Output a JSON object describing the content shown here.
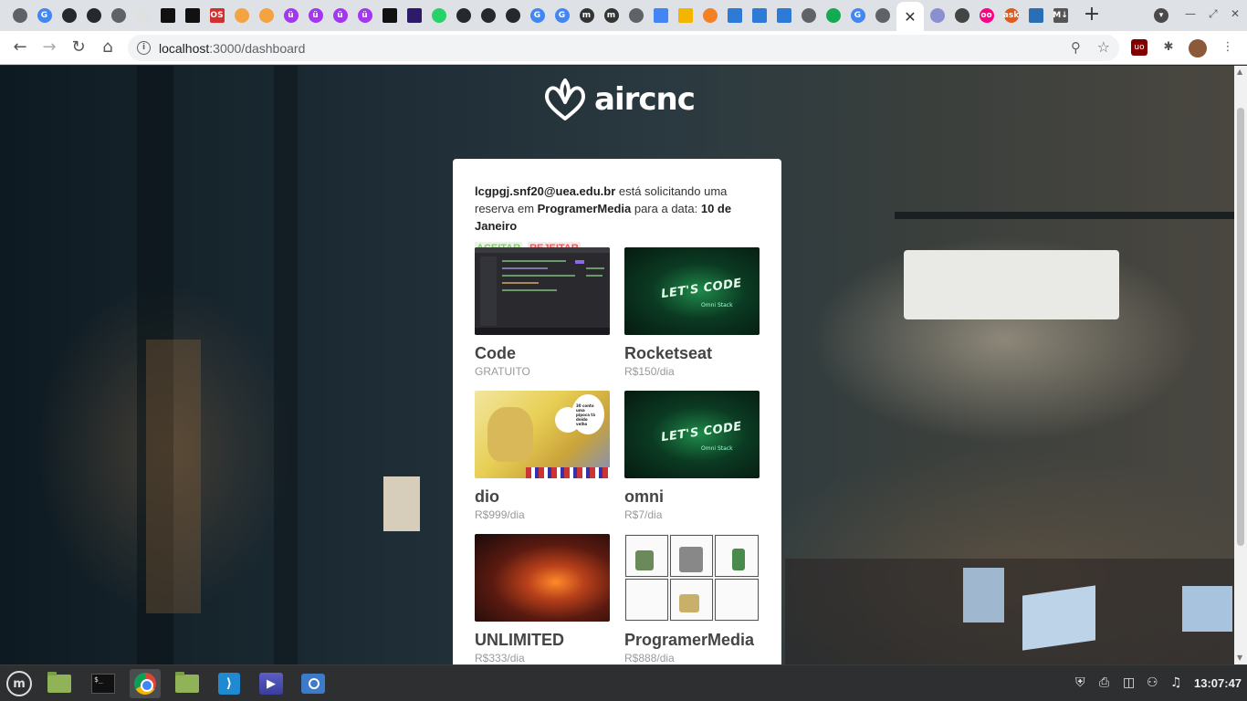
{
  "browser": {
    "active_tab_close": "✕",
    "new_tab": "+",
    "url_host": "localhost",
    "url_rest": ":3000/dashboard",
    "tab_favicons": [
      {
        "name": "globe-favicon",
        "label": "",
        "color": "#5f6368"
      },
      {
        "name": "google-favicon",
        "label": "G",
        "color": "#4285f4"
      },
      {
        "name": "github-favicon",
        "label": "",
        "color": "#24292e"
      },
      {
        "name": "github-favicon",
        "label": "",
        "color": "#24292e"
      },
      {
        "name": "globe-favicon",
        "label": "",
        "color": "#5f6368"
      },
      {
        "name": "blank-favicon",
        "label": "",
        "color": "#e0e0e0"
      },
      {
        "name": "codepen-favicon",
        "label": "",
        "color": "#111111"
      },
      {
        "name": "dev-favicon",
        "label": "",
        "color": "#111111"
      },
      {
        "name": "os-favicon",
        "label": "OS",
        "color": "#d32f2f"
      },
      {
        "name": "flag-favicon",
        "label": "",
        "color": "#f4a340"
      },
      {
        "name": "flag-favicon",
        "label": "",
        "color": "#f4a340"
      },
      {
        "name": "udemy-favicon",
        "label": "ü",
        "color": "#a435f0"
      },
      {
        "name": "udemy-favicon",
        "label": "ü",
        "color": "#a435f0"
      },
      {
        "name": "udemy-favicon",
        "label": "ü",
        "color": "#a435f0"
      },
      {
        "name": "udemy-favicon",
        "label": "ü",
        "color": "#a435f0"
      },
      {
        "name": "pen-favicon",
        "label": "",
        "color": "#111111"
      },
      {
        "name": "pen-favicon",
        "label": "",
        "color": "#2d1b69"
      },
      {
        "name": "whatsapp-favicon",
        "label": "",
        "color": "#25d366"
      },
      {
        "name": "github-favicon",
        "label": "",
        "color": "#24292e"
      },
      {
        "name": "github-favicon",
        "label": "",
        "color": "#24292e"
      },
      {
        "name": "github-favicon",
        "label": "",
        "color": "#24292e"
      },
      {
        "name": "google-favicon",
        "label": "G",
        "color": "#4285f4"
      },
      {
        "name": "google-favicon",
        "label": "G",
        "color": "#4285f4"
      },
      {
        "name": "medium-favicon",
        "label": "m",
        "color": "#333333"
      },
      {
        "name": "medium-favicon",
        "label": "m",
        "color": "#333333"
      },
      {
        "name": "globe-favicon",
        "label": "",
        "color": "#5f6368"
      },
      {
        "name": "docs-favicon",
        "label": "",
        "color": "#4285f4"
      },
      {
        "name": "slides-favicon",
        "label": "",
        "color": "#f4b400"
      },
      {
        "name": "stackoverflow-favicon",
        "label": "",
        "color": "#f48024"
      },
      {
        "name": "code-favicon",
        "label": "",
        "color": "#2d7bd6"
      },
      {
        "name": "code-favicon",
        "label": "",
        "color": "#2d7bd6"
      },
      {
        "name": "code-favicon",
        "label": "",
        "color": "#2d7bd6"
      },
      {
        "name": "globe-favicon",
        "label": "",
        "color": "#5f6368"
      },
      {
        "name": "mongodb-favicon",
        "label": "",
        "color": "#13aa52"
      },
      {
        "name": "google-favicon",
        "label": "G",
        "color": "#4285f4"
      },
      {
        "name": "chrome-favicon",
        "label": "",
        "color": "#5f6368"
      }
    ],
    "tab_favicons_after": [
      {
        "name": "shield-favicon",
        "label": "",
        "color": "#8a8fcf"
      },
      {
        "name": "box-favicon",
        "label": "",
        "color": "#444444"
      },
      {
        "name": "flickr-favicon",
        "label": "oo",
        "color": "#ff0084"
      },
      {
        "name": "ask-favicon",
        "label": "ask",
        "color": "#e05a1c"
      },
      {
        "name": "chart-favicon",
        "label": "",
        "color": "#2a6fb5"
      },
      {
        "name": "markdown-favicon",
        "label": "M↓",
        "color": "#555555"
      }
    ]
  },
  "page": {
    "brand": "aircnc",
    "request": {
      "email": "lcgpgj.snf20@uea.edu.br",
      "text_mid": " está solicitando uma reserva em ",
      "spot": "ProgramerMedia",
      "text_date": " para a data: ",
      "date": "10 de Janeiro"
    },
    "accept_label": "ACEITAR",
    "reject_label": "REJEITAR",
    "spots": [
      {
        "company": "Code",
        "price": "GRATUITO",
        "thumb": "code"
      },
      {
        "company": "Rocketseat",
        "price": "R$150/dia",
        "thumb": "letscode"
      },
      {
        "company": "dio",
        "price": "R$999/dia",
        "thumb": "dio"
      },
      {
        "company": "omni",
        "price": "R$7/dia",
        "thumb": "letscode"
      },
      {
        "company": "UNLIMITED",
        "price": "R$333/dia",
        "thumb": "space"
      },
      {
        "company": "ProgramerMedia",
        "price": "R$888/dia",
        "thumb": "comic"
      }
    ],
    "letscode_text": "LET'S CODE",
    "letscode_sub": "Omni Stack",
    "dio_bubble": "30 conto uma pipoca tá doido velho"
  },
  "taskbar": {
    "clock": "13:07:47",
    "terminal_prompt": "$_"
  }
}
